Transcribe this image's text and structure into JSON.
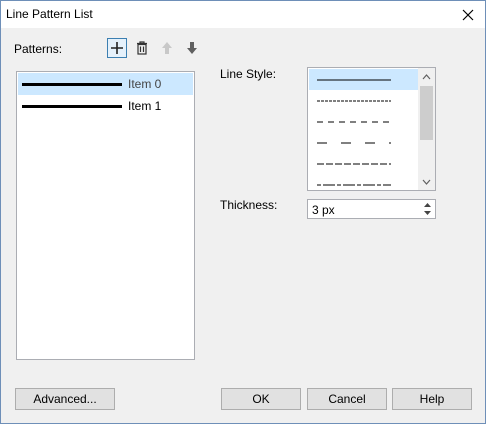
{
  "window": {
    "title": "Line Pattern List"
  },
  "patterns": {
    "label": "Patterns:",
    "items": [
      {
        "label": "Item 0",
        "selected": true
      },
      {
        "label": "Item 1",
        "selected": false
      }
    ]
  },
  "toolbar": {
    "icons": [
      "add-icon",
      "delete-icon",
      "move-up-icon",
      "move-down-icon"
    ]
  },
  "line_style": {
    "label": "Line Style:",
    "options": [
      "solid",
      "dotted",
      "dashed",
      "long-dash",
      "short-dash",
      "dash-dot"
    ],
    "selected_index": 0
  },
  "thickness": {
    "label": "Thickness:",
    "value": "3 px"
  },
  "buttons": {
    "advanced": "Advanced...",
    "ok": "OK",
    "cancel": "Cancel",
    "help": "Help"
  },
  "colors": {
    "selection": "#cce8ff",
    "accent": "#3c7fb1",
    "border": "#abadb3"
  }
}
